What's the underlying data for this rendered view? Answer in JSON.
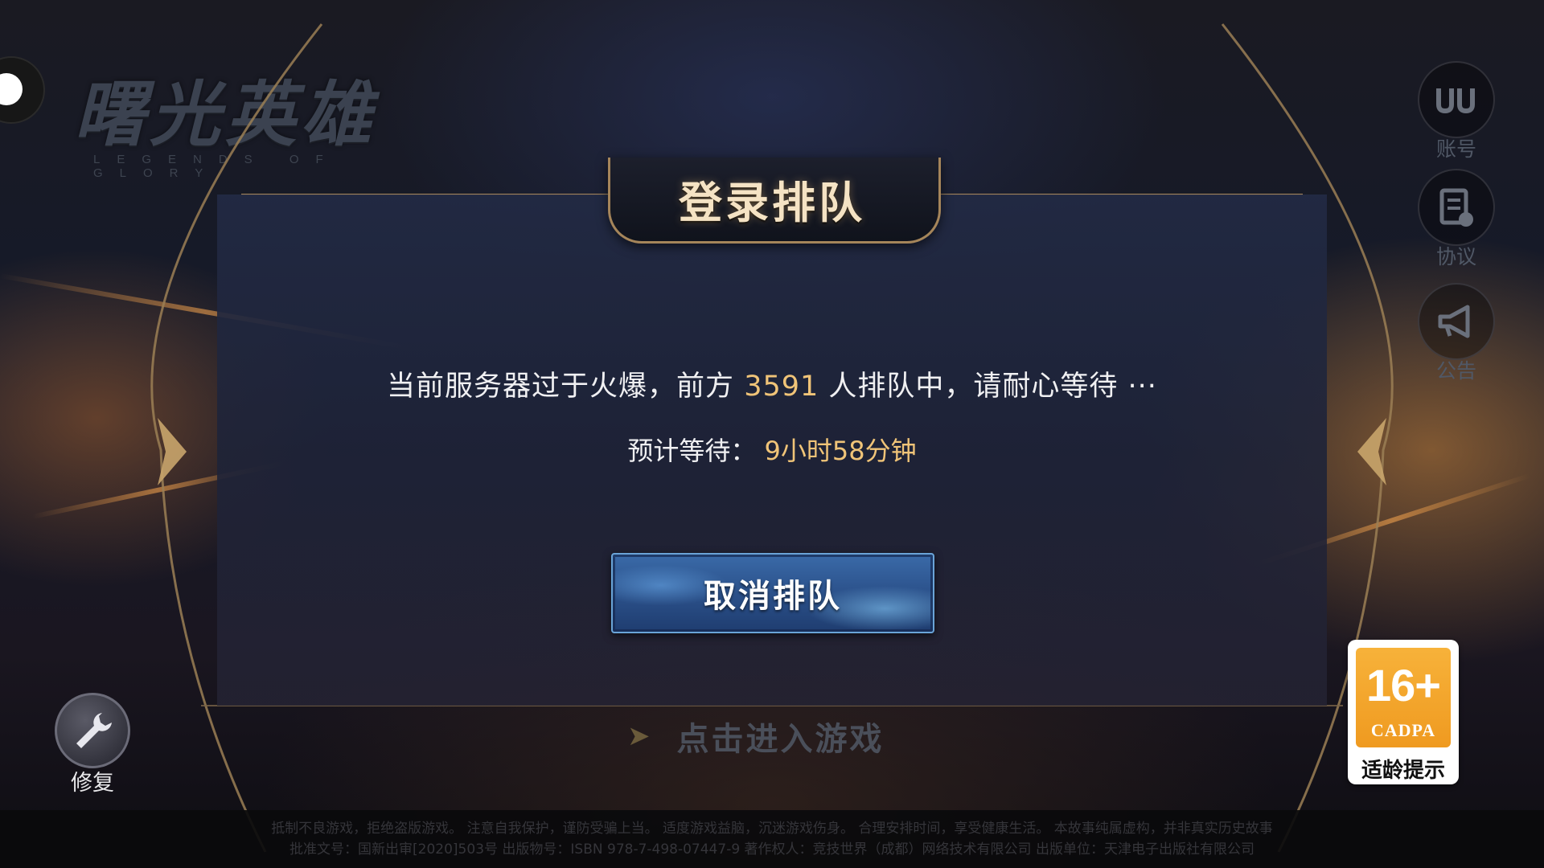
{
  "logo": {
    "title": "曙光英雄",
    "subtitle": "LEGENDS OF GLORY"
  },
  "side_buttons": {
    "account": {
      "label": "账号",
      "icon": "account-icon"
    },
    "agreement": {
      "label": "协议",
      "icon": "agreement-icon"
    },
    "notice": {
      "label": "公告",
      "icon": "megaphone-icon"
    }
  },
  "dialog": {
    "title": "登录排队",
    "message_prefix": "当前服务器过于火爆，前方",
    "queue_count": "3591",
    "message_suffix": "人排队中，请耐心等待 ···",
    "estimate_label": "预计等待：",
    "estimate_value": "9小时58分钟",
    "cancel_label": "取消排队"
  },
  "enter_game": {
    "label": "点击进入游戏",
    "icon": "chevron-right-icon"
  },
  "repair": {
    "label": "修复",
    "icon": "wrench-icon"
  },
  "age_rating": {
    "rating": "16+",
    "org": "CADPA",
    "label": "适龄提示"
  },
  "footer": {
    "line1": "抵制不良游戏，拒绝盗版游戏。 注意自我保护，谨防受骗上当。 适度游戏益脑，沉迷游戏伤身。 合理安排时间，享受健康生活。 本故事纯属虚构，并非真实历史故事",
    "line2": "批准文号：国新出审[2020]503号  出版物号：ISBN 978-7-498-07447-9  著作权人：竞技世界（成都）网络技术有限公司  出版单位：天津电子出版社有限公司"
  },
  "colors": {
    "accent_gold": "#f0c478",
    "frame_gold": "#a5855a",
    "button_blue": "#2a4f88",
    "badge_orange": "#f7b23a"
  }
}
